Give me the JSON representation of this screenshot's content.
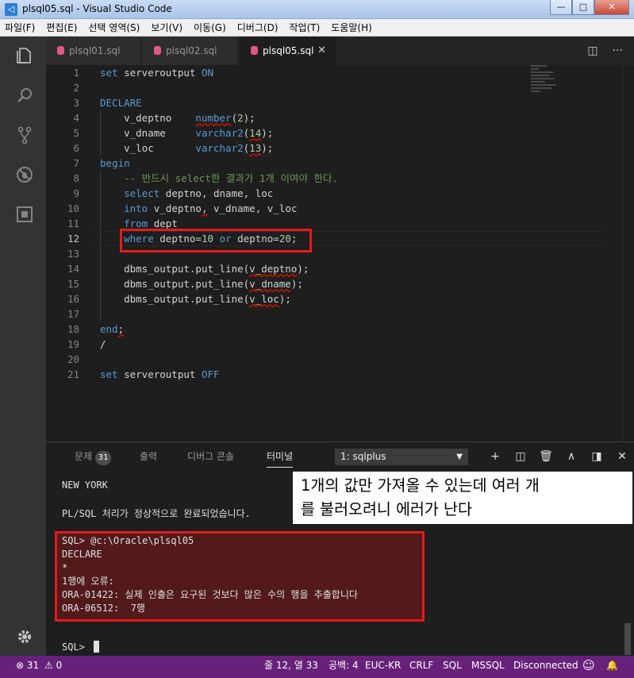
{
  "window": {
    "title": "plsql05.sql - Visual Studio Code",
    "controls": [
      "—",
      "□",
      "✕"
    ]
  },
  "menu": [
    "파일(F)",
    "편집(E)",
    "선택 영역(S)",
    "보기(V)",
    "이동(G)",
    "디버그(D)",
    "작업(T)",
    "도움말(H)"
  ],
  "activity_icons": [
    "files-icon",
    "search-icon",
    "source-control-icon",
    "debug-icon",
    "extensions-icon",
    "gear-icon"
  ],
  "tabs": [
    {
      "label": "plsql01.sql",
      "active": false
    },
    {
      "label": "plsql02.sql",
      "active": false
    },
    {
      "label": "plsql05.sql",
      "active": true
    }
  ],
  "tab_close": "✕",
  "tab_actions": {
    "split": "◫",
    "more": "···"
  },
  "editor": {
    "current_line": 12,
    "lines": [
      {
        "n": "1",
        "t": "set serveroutput ON"
      },
      {
        "n": "2",
        "t": ""
      },
      {
        "n": "3",
        "t": "DECLARE"
      },
      {
        "n": "4",
        "t": "    v_deptno    number(2);"
      },
      {
        "n": "5",
        "t": "    v_dname     varchar2(14);"
      },
      {
        "n": "6",
        "t": "    v_loc       varchar2(13);"
      },
      {
        "n": "7",
        "t": "begin"
      },
      {
        "n": "8",
        "t": "    -- 반드시 select한 결과가 1개 이여야 한다."
      },
      {
        "n": "9",
        "t": "    select deptno, dname, loc"
      },
      {
        "n": "10",
        "t": "    into v_deptno, v_dname, v_loc"
      },
      {
        "n": "11",
        "t": "    from dept"
      },
      {
        "n": "12",
        "t": "    where deptno=10 or deptno=20;"
      },
      {
        "n": "13",
        "t": ""
      },
      {
        "n": "14",
        "t": "    dbms_output.put_line(v_deptno);"
      },
      {
        "n": "15",
        "t": "    dbms_output.put_line(v_dname);"
      },
      {
        "n": "16",
        "t": "    dbms_output.put_line(v_loc);"
      },
      {
        "n": "17",
        "t": ""
      },
      {
        "n": "18",
        "t": "end;"
      },
      {
        "n": "19",
        "t": "/"
      },
      {
        "n": "20",
        "t": ""
      },
      {
        "n": "21",
        "t": "set serveroutput OFF"
      }
    ]
  },
  "panel": {
    "tabs": [
      {
        "label": "문제",
        "badge": "31"
      },
      {
        "label": "출력"
      },
      {
        "label": "디버그 콘솔"
      },
      {
        "label": "터미널",
        "active": true
      }
    ],
    "terminal_select": "1: sqlplus",
    "select_caret": "▼",
    "actions": [
      "+",
      "◫",
      "🗑",
      "∧",
      "◨",
      "✕"
    ],
    "terminal_lines": [
      "NEW YORK",
      "",
      "PL/SQL 처리가 정상적으로 완료되었습니다.",
      "",
      "SQL> @c:\\Oracle\\plsql05",
      "DECLARE",
      "*",
      "1행에 오류:",
      "ORA-01422: 실제 인출은 요구된 것보다 많은 수의 행을 추출합니다",
      "ORA-06512:  7행",
      "",
      "",
      "SQL> "
    ]
  },
  "callout": {
    "line1": "1개의 값만 가져올 수 있는데 여러 개",
    "line2": "를 불러오려니 에러가 난다"
  },
  "status": {
    "errors": "⊗ 31",
    "warnings": "⚠ 0",
    "position": "줄 12, 열 33",
    "spaces": "공백: 4",
    "encoding": "EUC-KR",
    "eol": "CRLF",
    "language": "SQL",
    "connection_type": "MSSQL",
    "connection": "Disconnected",
    "smile": "☺",
    "bell": "🔔"
  }
}
